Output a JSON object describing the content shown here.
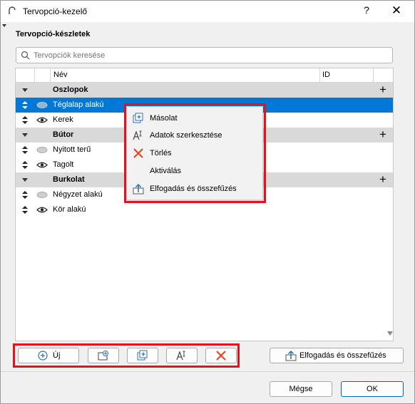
{
  "window": {
    "title": "Tervopció-kezelő",
    "help": "?",
    "close": "✕"
  },
  "panel": {
    "section_title": "Tervopció-készletek",
    "search_placeholder": "Tervopciók keresése"
  },
  "list": {
    "columns": [
      "Név",
      "ID"
    ],
    "rows": [
      {
        "kind": "group",
        "label": "Oszlopok"
      },
      {
        "kind": "item",
        "label": "Téglalap alakú",
        "selected": true,
        "visible": false
      },
      {
        "kind": "item",
        "label": "Kerek",
        "selected": false,
        "visible": true
      },
      {
        "kind": "group",
        "label": "Bútor"
      },
      {
        "kind": "item",
        "label": "Nyitott terű",
        "selected": false,
        "visible": false
      },
      {
        "kind": "item",
        "label": "Tagolt",
        "selected": false,
        "visible": true
      },
      {
        "kind": "group",
        "label": "Burkolat"
      },
      {
        "kind": "item",
        "label": "Négyzet alakú",
        "selected": false,
        "visible": false
      },
      {
        "kind": "item",
        "label": "Kör alakú",
        "selected": false,
        "visible": true
      }
    ]
  },
  "context_menu": {
    "items": [
      {
        "label": "Másolat",
        "icon": "duplicate-icon"
      },
      {
        "label": "Adatok szerkesztése",
        "icon": "edit-text-icon"
      },
      {
        "label": "Törlés",
        "icon": "delete-x-icon"
      },
      {
        "label": "Aktiválás",
        "icon": ""
      },
      {
        "label": "Elfogadás és összefűzés",
        "icon": "accept-merge-icon"
      }
    ]
  },
  "toolbar": {
    "new_label": "Új",
    "accept_merge_label": "Elfogadás és összefűzés"
  },
  "footer": {
    "cancel_label": "Mégse",
    "ok_label": "OK"
  },
  "colors": {
    "selection": "#0078d7",
    "group_row": "#d9d9d9",
    "highlight_box": "#e0141d",
    "delete_red": "#e8401c"
  }
}
